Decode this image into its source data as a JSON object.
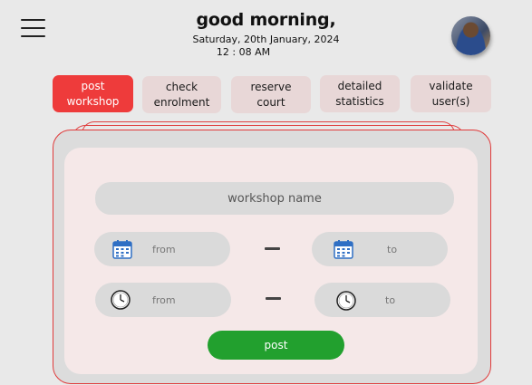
{
  "header": {
    "greeting": "good morning,",
    "date": "Saturday, 20th January, 2024",
    "time": "12 : 08 AM"
  },
  "tabs": [
    {
      "label_line1": "post",
      "label_line2": "workshop",
      "active": true
    },
    {
      "label_line1": "check",
      "label_line2": "enrolment",
      "active": false
    },
    {
      "label_line1": "reserve",
      "label_line2": "court",
      "active": false
    },
    {
      "label_line1": "detailed",
      "label_line2": "statistics",
      "active": false
    },
    {
      "label_line1": "validate",
      "label_line2": "user(s)",
      "active": false
    }
  ],
  "form": {
    "workshop_name_placeholder": "workshop name",
    "date_from_label": "from",
    "date_to_label": "to",
    "time_from_label": "from",
    "time_to_label": "to",
    "post_label": "post"
  },
  "colors": {
    "accent_red": "#ee3b3b",
    "post_green": "#22a02e",
    "card_bg": "#f5e8e8",
    "field_bg": "#dadada"
  },
  "icons": {
    "menu": "hamburger-menu-icon",
    "date": "calendar-icon",
    "time": "clock-icon"
  }
}
